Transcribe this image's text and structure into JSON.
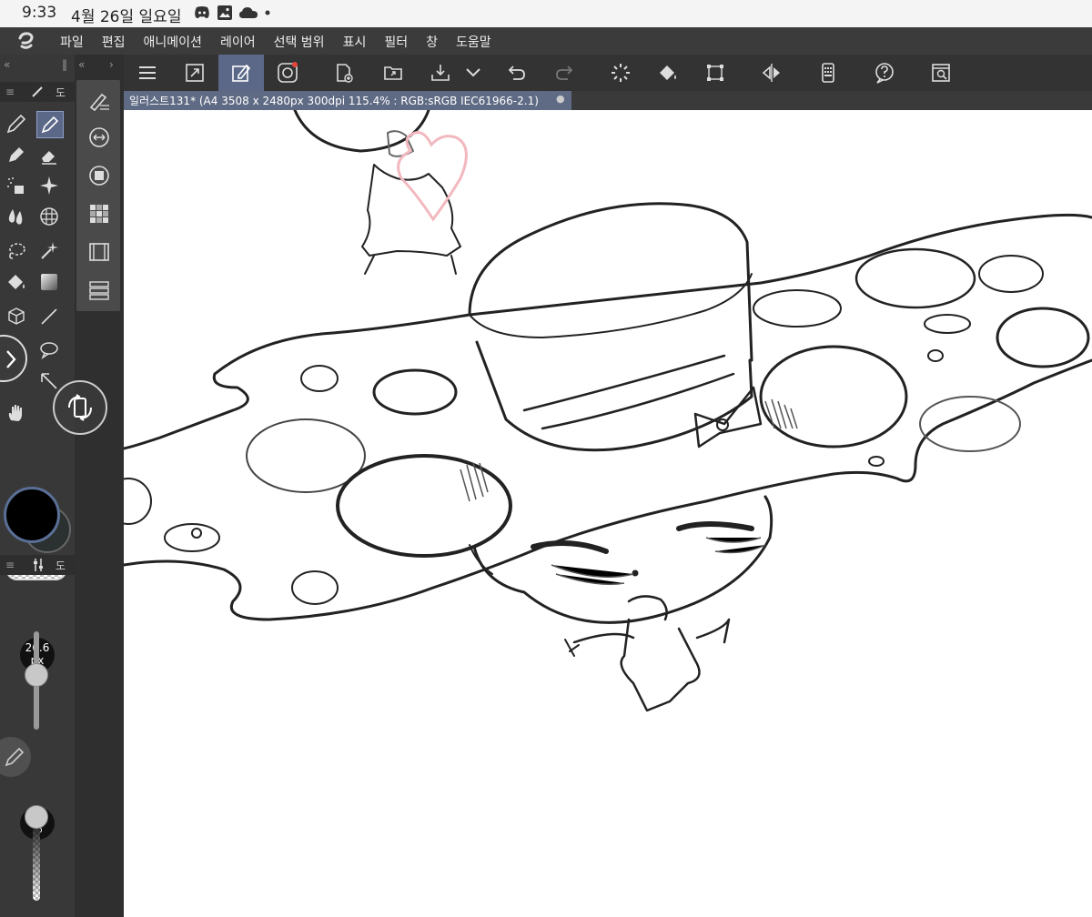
{
  "status_bar": {
    "time": "9:33",
    "date": "4월 26일 일요일",
    "icons": [
      "discord-icon",
      "image-icon",
      "cloud-icon",
      "dot-icon"
    ]
  },
  "menu": {
    "items": [
      "파일",
      "편집",
      "애니메이션",
      "레이어",
      "선택 범위",
      "표시",
      "필터",
      "창",
      "도움말"
    ]
  },
  "panel_headers": {
    "tool_tab_label": "도",
    "sub_tab_label": "도"
  },
  "document": {
    "tab_title": "일러스트131* (A4 3508 x 2480px 300dpi 115.4% : RGB:sRGB IEC61966-2.1)"
  },
  "brush": {
    "size_value": "26.6",
    "size_unit": "px",
    "size_level": 0.6,
    "opacity_value": "100",
    "opacity_unit": "%",
    "opacity_level": 1.0
  },
  "colors": {
    "main": "#000000",
    "sub": "#2b3030",
    "accent": "#5b6887",
    "heart": "#f2b8bf"
  }
}
